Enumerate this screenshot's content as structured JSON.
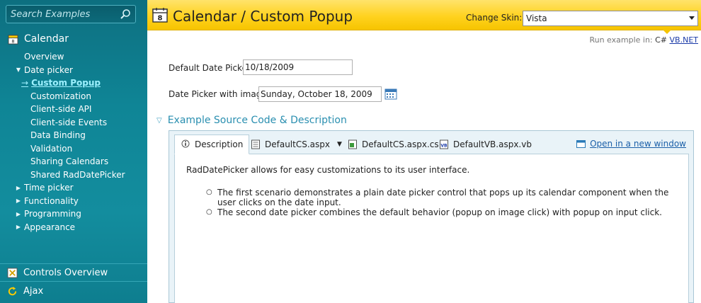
{
  "sidebar": {
    "search_placeholder": "Search Examples",
    "section_title": "Calendar",
    "items": [
      {
        "label": "Overview"
      },
      {
        "label": "Date picker"
      },
      {
        "label": "Custom Popup"
      },
      {
        "label": "Customization"
      },
      {
        "label": "Client-side API"
      },
      {
        "label": "Client-side Events"
      },
      {
        "label": "Data Binding"
      },
      {
        "label": "Validation"
      },
      {
        "label": "Sharing Calendars"
      },
      {
        "label": "Shared RadDatePicker"
      },
      {
        "label": "Time picker"
      },
      {
        "label": "Functionality"
      },
      {
        "label": "Programming"
      },
      {
        "label": "Appearance"
      }
    ],
    "bottom": {
      "controls_overview": "Controls Overview",
      "ajax": "Ajax"
    }
  },
  "header": {
    "title": "Calendar / Custom Popup",
    "skin_label": "Change Skin:",
    "skin_value": "Vista"
  },
  "run_example": {
    "label": "Run example in:",
    "cs": "C#",
    "vb": "VB.NET"
  },
  "form": {
    "default_label": "Default Date Picker:",
    "default_value": "10/18/2009",
    "image_label": "Date Picker with image:",
    "image_value": "Sunday, October 18, 2009"
  },
  "source": {
    "heading": "Example Source Code & Description",
    "tabs": [
      {
        "label": "Description"
      },
      {
        "label": "DefaultCS.aspx"
      },
      {
        "label": "DefaultCS.aspx.cs"
      },
      {
        "label": "DefaultVB.aspx.vb"
      }
    ],
    "open_new": "Open in a new window",
    "intro": "RadDatePicker allows for easy customizations to its user interface.",
    "bullets": [
      "The first scenario demonstrates a plain date picker control that pops up its calendar component when the user clicks on the date input.",
      "The second date picker combines the default behavior (popup on image click) with popup on input click."
    ]
  },
  "colors": {
    "sidebar_bg": "#0f8596",
    "header_bg": "#ffd21f",
    "link": "#1a5fa8",
    "accent_text": "#2a8fb0"
  }
}
